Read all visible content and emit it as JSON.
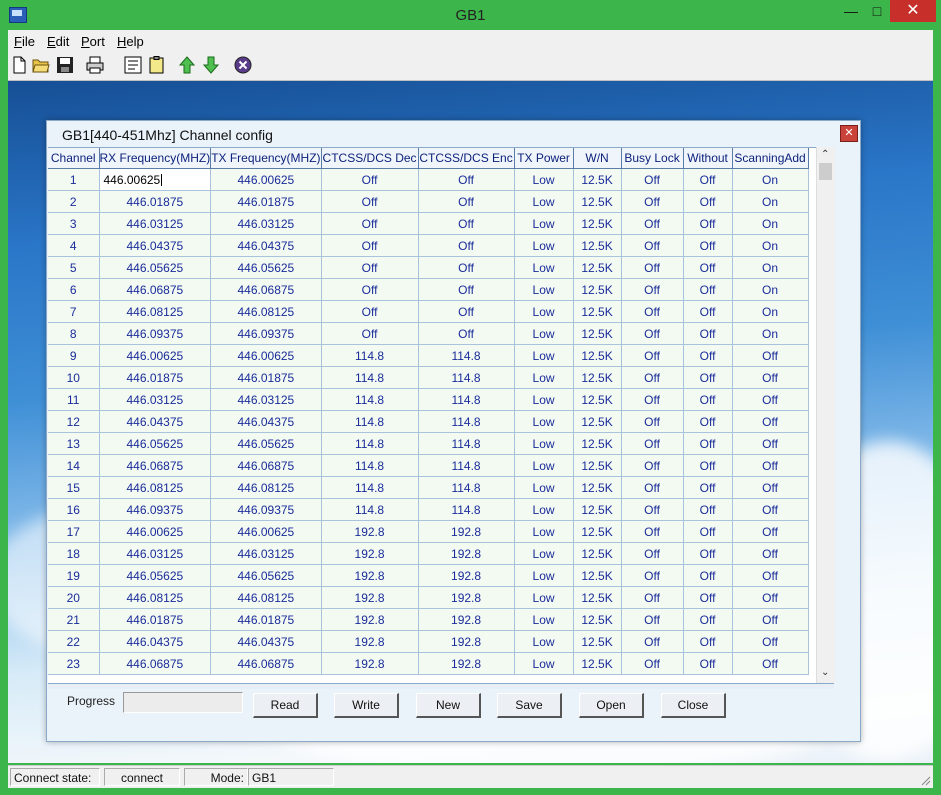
{
  "window": {
    "title": "GB1"
  },
  "menu": [
    "File",
    "Edit",
    "Port",
    "Help"
  ],
  "toolbar_icons": [
    "new-file-icon",
    "open-folder-icon",
    "save-disk-icon",
    "print-icon",
    "properties-icon",
    "clipboard-icon",
    "upload-arrow-icon",
    "download-arrow-icon",
    "stop-icon"
  ],
  "dialog": {
    "title": "GB1[440-451Mhz] Channel config",
    "columns": [
      "Channel",
      "RX Frequency(MHZ)",
      "TX Frequency(MHZ)",
      "CTCSS/DCS Dec",
      "CTCSS/DCS Enc",
      "TX Power",
      "W/N",
      "Busy Lock",
      "Without",
      "ScanningAdd"
    ],
    "rows": [
      [
        "1",
        "446.00625",
        "446.00625",
        "Off",
        "Off",
        "Low",
        "12.5K",
        "Off",
        "Off",
        "On"
      ],
      [
        "2",
        "446.01875",
        "446.01875",
        "Off",
        "Off",
        "Low",
        "12.5K",
        "Off",
        "Off",
        "On"
      ],
      [
        "3",
        "446.03125",
        "446.03125",
        "Off",
        "Off",
        "Low",
        "12.5K",
        "Off",
        "Off",
        "On"
      ],
      [
        "4",
        "446.04375",
        "446.04375",
        "Off",
        "Off",
        "Low",
        "12.5K",
        "Off",
        "Off",
        "On"
      ],
      [
        "5",
        "446.05625",
        "446.05625",
        "Off",
        "Off",
        "Low",
        "12.5K",
        "Off",
        "Off",
        "On"
      ],
      [
        "6",
        "446.06875",
        "446.06875",
        "Off",
        "Off",
        "Low",
        "12.5K",
        "Off",
        "Off",
        "On"
      ],
      [
        "7",
        "446.08125",
        "446.08125",
        "Off",
        "Off",
        "Low",
        "12.5K",
        "Off",
        "Off",
        "On"
      ],
      [
        "8",
        "446.09375",
        "446.09375",
        "Off",
        "Off",
        "Low",
        "12.5K",
        "Off",
        "Off",
        "On"
      ],
      [
        "9",
        "446.00625",
        "446.00625",
        "114.8",
        "114.8",
        "Low",
        "12.5K",
        "Off",
        "Off",
        "Off"
      ],
      [
        "10",
        "446.01875",
        "446.01875",
        "114.8",
        "114.8",
        "Low",
        "12.5K",
        "Off",
        "Off",
        "Off"
      ],
      [
        "11",
        "446.03125",
        "446.03125",
        "114.8",
        "114.8",
        "Low",
        "12.5K",
        "Off",
        "Off",
        "Off"
      ],
      [
        "12",
        "446.04375",
        "446.04375",
        "114.8",
        "114.8",
        "Low",
        "12.5K",
        "Off",
        "Off",
        "Off"
      ],
      [
        "13",
        "446.05625",
        "446.05625",
        "114.8",
        "114.8",
        "Low",
        "12.5K",
        "Off",
        "Off",
        "Off"
      ],
      [
        "14",
        "446.06875",
        "446.06875",
        "114.8",
        "114.8",
        "Low",
        "12.5K",
        "Off",
        "Off",
        "Off"
      ],
      [
        "15",
        "446.08125",
        "446.08125",
        "114.8",
        "114.8",
        "Low",
        "12.5K",
        "Off",
        "Off",
        "Off"
      ],
      [
        "16",
        "446.09375",
        "446.09375",
        "114.8",
        "114.8",
        "Low",
        "12.5K",
        "Off",
        "Off",
        "Off"
      ],
      [
        "17",
        "446.00625",
        "446.00625",
        "192.8",
        "192.8",
        "Low",
        "12.5K",
        "Off",
        "Off",
        "Off"
      ],
      [
        "18",
        "446.03125",
        "446.03125",
        "192.8",
        "192.8",
        "Low",
        "12.5K",
        "Off",
        "Off",
        "Off"
      ],
      [
        "19",
        "446.05625",
        "446.05625",
        "192.8",
        "192.8",
        "Low",
        "12.5K",
        "Off",
        "Off",
        "Off"
      ],
      [
        "20",
        "446.08125",
        "446.08125",
        "192.8",
        "192.8",
        "Low",
        "12.5K",
        "Off",
        "Off",
        "Off"
      ],
      [
        "21",
        "446.01875",
        "446.01875",
        "192.8",
        "192.8",
        "Low",
        "12.5K",
        "Off",
        "Off",
        "Off"
      ],
      [
        "22",
        "446.04375",
        "446.04375",
        "192.8",
        "192.8",
        "Low",
        "12.5K",
        "Off",
        "Off",
        "Off"
      ],
      [
        "23",
        "446.06875",
        "446.06875",
        "192.8",
        "192.8",
        "Low",
        "12.5K",
        "Off",
        "Off",
        "Off"
      ]
    ],
    "progress_label": "Progress",
    "buttons": [
      "Read",
      "Write",
      "New",
      "Save",
      "Open",
      "Close"
    ]
  },
  "status": {
    "connect_label": "Connect state:",
    "connect_value": "connect",
    "mode_label": "Mode:",
    "mode_value": "GB1"
  }
}
